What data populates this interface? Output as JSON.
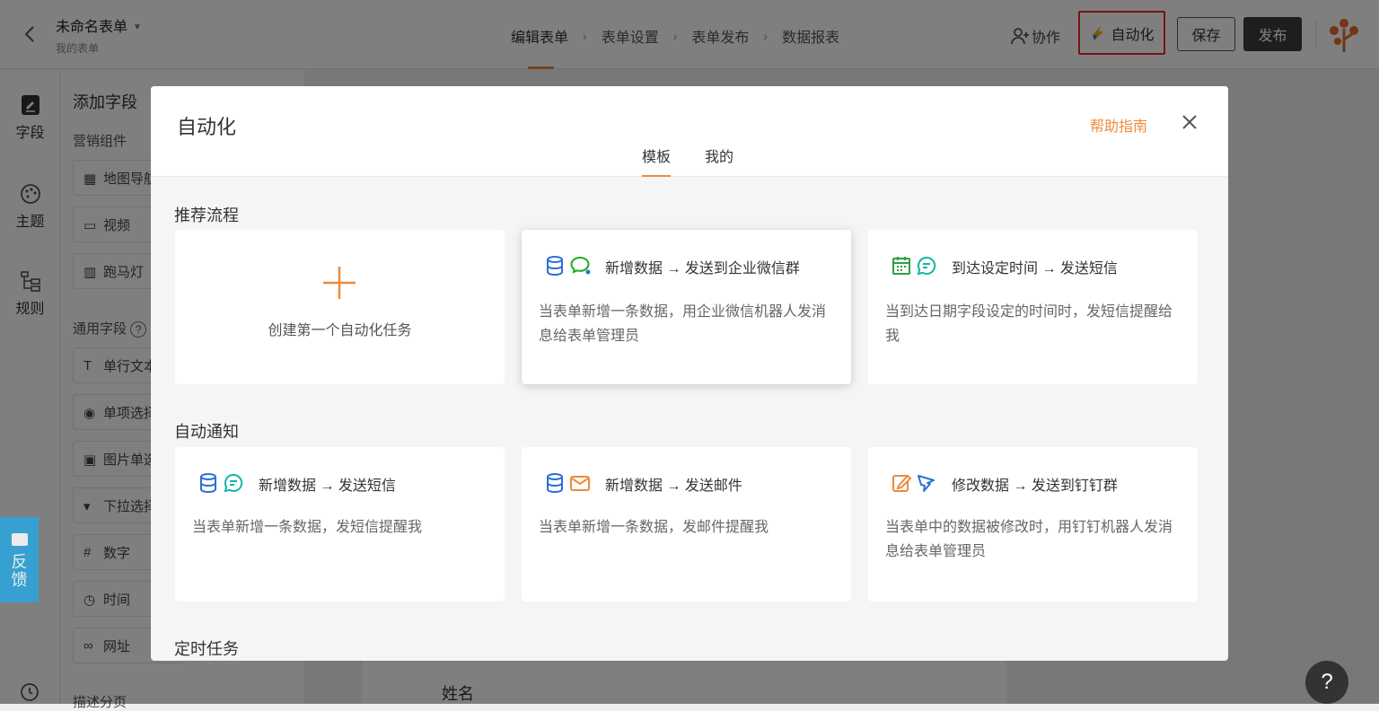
{
  "header": {
    "form_title": "未命名表单",
    "form_subtitle": "我的表单",
    "steps": [
      "编辑表单",
      "表单设置",
      "表单发布",
      "数据报表"
    ],
    "collab_label": "协作",
    "automation_label": "自动化",
    "save_label": "保存",
    "publish_label": "发布"
  },
  "leftnav": {
    "items": [
      {
        "label": "字段",
        "icon": "edit-icon"
      },
      {
        "label": "主题",
        "icon": "palette-icon"
      },
      {
        "label": "规则",
        "icon": "rules-icon"
      }
    ]
  },
  "field_panel": {
    "title": "添加字段",
    "marketing_group": "营销组件",
    "marketing_fields": [
      "地图导航",
      "视频",
      "跑马灯"
    ],
    "common_group": "通用字段",
    "common_fields": [
      "单行文本",
      "单项选择",
      "图片单选",
      "下拉选择",
      "数字",
      "时间",
      "网址"
    ],
    "last_group": "描述分页"
  },
  "canvas": {
    "field_label": "姓名"
  },
  "feedback": {
    "label": "反馈"
  },
  "help_button": {
    "label": "?"
  },
  "modal": {
    "title": "自动化",
    "help_link": "帮助指南",
    "tabs": [
      "模板",
      "我的"
    ],
    "sections": [
      {
        "title": "推荐流程",
        "create_label": "创建第一个自动化任务",
        "cards": [
          {
            "head": "新增数据 → 发送到企业微信群",
            "desc": "当表单新增一条数据，用企业微信机器人发消息给表单管理员"
          },
          {
            "head": "到达设定时间 → 发送短信",
            "desc": "当到达日期字段设定的时间时，发短信提醒给我"
          }
        ]
      },
      {
        "title": "自动通知",
        "cards": [
          {
            "head": "新增数据 → 发送短信",
            "desc": "当表单新增一条数据，发短信提醒我"
          },
          {
            "head": "新增数据 → 发送邮件",
            "desc": "当表单新增一条数据，发邮件提醒我"
          },
          {
            "head": "修改数据 → 发送到钉钉群",
            "desc": "当表单中的数据被修改时，用钉钉机器人发消息给表单管理员"
          }
        ]
      },
      {
        "title": "定时任务"
      }
    ]
  },
  "colors": {
    "accent": "#f08a3a",
    "highlight_border": "#e8262b",
    "feedback_bg": "#2aa7e0"
  }
}
